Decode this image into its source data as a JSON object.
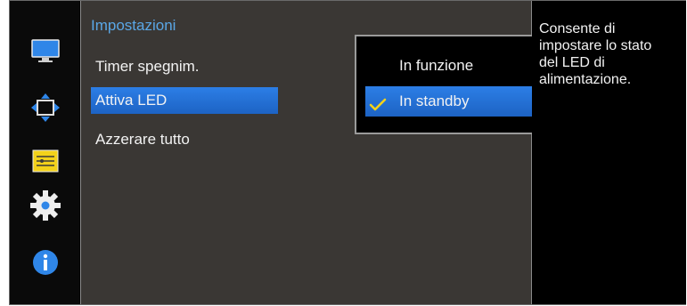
{
  "sidebar": {
    "icons": [
      {
        "name": "picture-icon"
      },
      {
        "name": "screen-adjust-icon"
      },
      {
        "name": "settings-menu-icon"
      },
      {
        "name": "gear-icon"
      },
      {
        "name": "info-icon"
      }
    ]
  },
  "menu": {
    "title": "Impostazioni",
    "items": [
      {
        "label": "Timer spegnim."
      },
      {
        "label": "Attiva LED"
      },
      {
        "label": "Azzerare tutto"
      }
    ],
    "selected_index": 1
  },
  "submenu": {
    "options": [
      {
        "label": "In funzione"
      },
      {
        "label": "In standby"
      }
    ],
    "selected_index": 1
  },
  "description": "Consente di impostare lo stato del LED di alimentazione.",
  "colors": {
    "accent": "#1f6fd8",
    "title": "#5aa7e6",
    "check": "#f3d21a",
    "panel": "#3a3734"
  }
}
